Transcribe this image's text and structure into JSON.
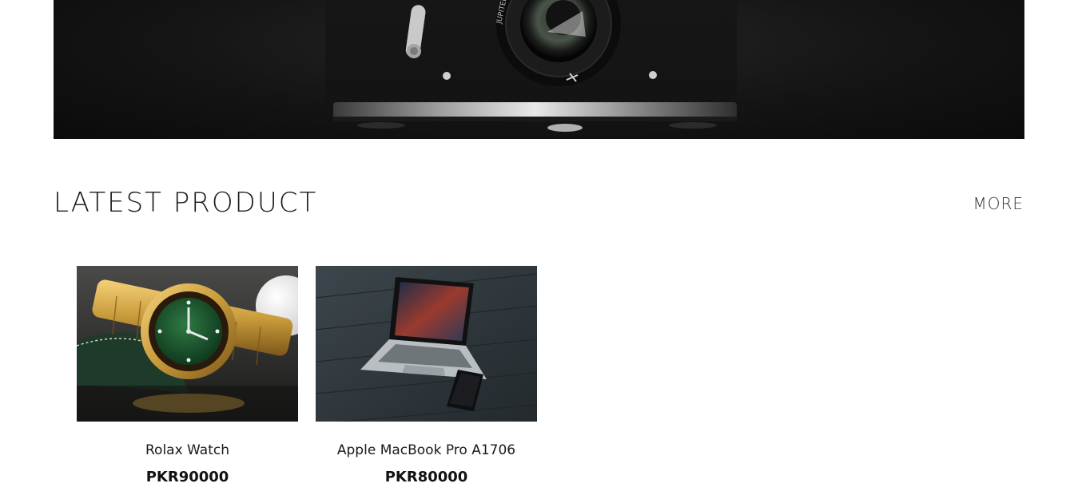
{
  "section": {
    "title": "LATEST PRODUCT",
    "more_label": "MORE"
  },
  "hero": {
    "image_icon": "camera-photo",
    "lens_text": "JUPITER"
  },
  "products": [
    {
      "name": "Rolax Watch",
      "price": "PKR90000",
      "image_icon": "watch-photo"
    },
    {
      "name": "Apple MacBook Pro A1706",
      "price": "PKR80000",
      "image_icon": "laptop-photo"
    }
  ],
  "colors": {
    "hero_bg": "#141414",
    "text_dark": "#1a1a1a"
  }
}
